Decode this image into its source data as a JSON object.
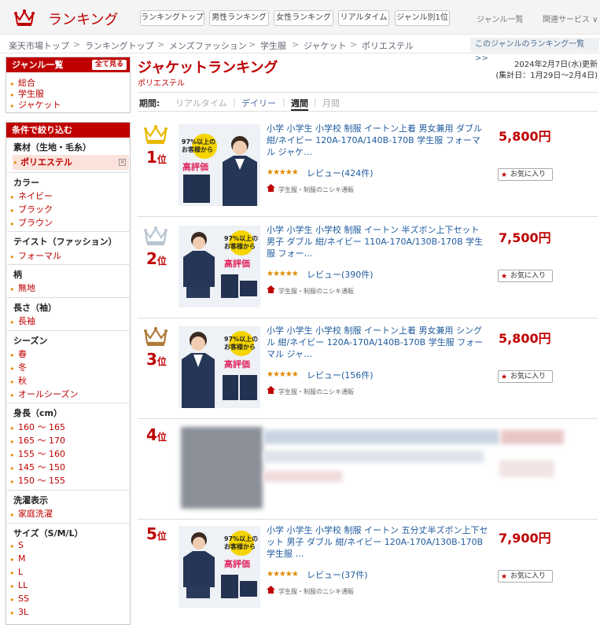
{
  "header": {
    "brand": "ランキング",
    "tabs": [
      "ランキングトップ",
      "男性ランキング",
      "女性ランキング",
      "リアルタイム",
      "ジャンル別1位"
    ],
    "links": [
      "ジャンル一覧",
      "関連サービス ∨"
    ]
  },
  "breadcrumb": {
    "items": [
      "楽天市場トップ",
      "ランキングトップ",
      "メンズファッション",
      "学生服",
      "ジャケット",
      "ポリエステル"
    ],
    "sep": ">",
    "genre_link": "このジャンルのランキング一覧 >>"
  },
  "sidebar": {
    "genre_title": "ジャンル一覧",
    "see_all": "全て見る",
    "genres": [
      "総合",
      "学生服",
      "ジャケット"
    ],
    "filter_title": "条件で絞り込む",
    "material": {
      "heading": "素材（生地・毛糸）",
      "selected": "ポリエステル"
    },
    "color": {
      "heading": "カラー",
      "items": [
        "ネイビー",
        "ブラック",
        "ブラウン"
      ]
    },
    "taste": {
      "heading": "テイスト（ファッション）",
      "items": [
        "フォーマル"
      ]
    },
    "pattern": {
      "heading": "柄",
      "items": [
        "無地"
      ]
    },
    "sleeve": {
      "heading": "長さ（袖）",
      "items": [
        "長袖"
      ]
    },
    "season": {
      "heading": "シーズン",
      "items": [
        "春",
        "冬",
        "秋",
        "オールシーズン"
      ]
    },
    "height": {
      "heading": "身長（cm）",
      "items": [
        "160 ～ 165",
        "165 ～ 170",
        "155 ～ 160",
        "145 ～ 150",
        "150 ～ 155"
      ]
    },
    "wash": {
      "heading": "洗濯表示",
      "items": [
        "家庭洗濯"
      ]
    },
    "size": {
      "heading": "サイズ（S/M/L）",
      "items": [
        "S",
        "M",
        "L",
        "LL",
        "SS",
        "3L"
      ]
    }
  },
  "main": {
    "title": "ジャケットランキング",
    "subtitle": "ポリエステル",
    "updated": "2024年2月7日(水)更新",
    "period_note": "(集計日：1月29日～2月4日)",
    "period_label": "期間:",
    "periods": [
      "リアルタイム",
      "デイリー",
      "週間",
      "月間"
    ],
    "rank_suffix": "位",
    "fav_label": "お気に入り",
    "badge": {
      "line1": "97%以上の",
      "line2": "お客様から",
      "line3": "高評価"
    },
    "items": [
      {
        "rank": "1",
        "title": "小学 小学生 小学校 制服 イートン上着 男女兼用 ダブル 紺/ネイビー 120A-170A/140B-170B 学生服 フォーマル ジャケ…",
        "rating": "★★★★★",
        "reviews": "レビュー(424件)",
        "shop": "学生服・制服のニシキ通販",
        "price": "5,800円",
        "crown": "gold"
      },
      {
        "rank": "2",
        "title": "小学 小学生 小学校 制服 イートン 半ズボン上下セット 男子 ダブル 紺/ネイビー 110A-170A/130B-170B 学生服 フォー…",
        "rating": "★★★★★",
        "reviews": "レビュー(390件)",
        "shop": "学生服・制服のニシキ通販",
        "price": "7,500円",
        "crown": "silver"
      },
      {
        "rank": "3",
        "title": "小学 小学生 小学校 制服 イートン上着 男女兼用 シングル 紺/ネイビー 120A-170A/140B-170B 学生服 フォーマル ジャ…",
        "rating": "★★★★★",
        "reviews": "レビュー(156件)",
        "shop": "学生服・制服のニシキ通販",
        "price": "5,800円",
        "crown": "bronze"
      },
      {
        "rank": "4",
        "title": "",
        "rating": "",
        "reviews": "",
        "shop": "",
        "price": "",
        "crown": "none"
      },
      {
        "rank": "5",
        "title": "小学 小学生 小学校 制服 イートン 五分丈半ズボン上下セット 男子 ダブル 紺/ネイビー 120A-170A/130B-170B 学生服 …",
        "rating": "★★★★★",
        "reviews": "レビュー(37件)",
        "shop": "学生服・制服のニシキ通販",
        "price": "7,900円",
        "crown": "none"
      }
    ]
  },
  "colors": {
    "accent": "#bf0000",
    "link": "#1e5a9e",
    "gold": "#e8b800",
    "silver": "#b9c6d2",
    "bronze": "#b07a3a"
  }
}
